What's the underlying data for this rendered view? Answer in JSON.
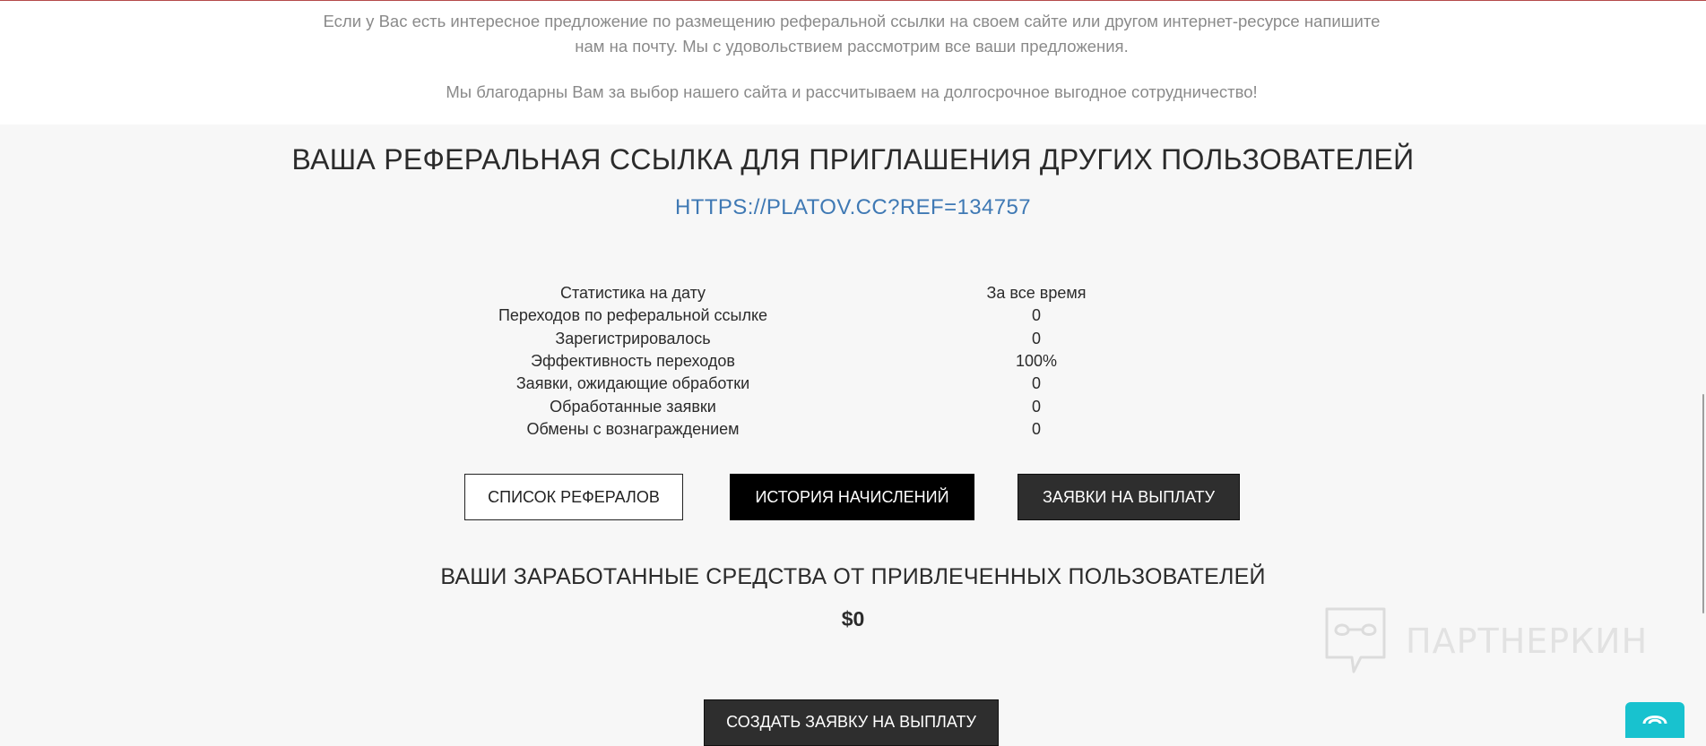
{
  "intro": {
    "paragraph1": "Если у Вас есть интересное предложение по размещению реферальной ссылки на своем сайте или другом интернет-ресурсе напишите нам на почту. Мы с удовольствием рассмотрим все ваши предложения.",
    "paragraph2": "Мы благодарны Вам за выбор нашего сайта и рассчитываем на долгосрочное выгодное сотрудничество!"
  },
  "referral": {
    "heading": "ВАША РЕФЕРАЛЬНАЯ ССЫЛКА ДЛЯ ПРИГЛАШЕНИЯ ДРУГИХ ПОЛЬЗОВАТЕЛЕЙ",
    "link": "HTTPS://PLATOV.CC?REF=134757"
  },
  "stats": {
    "header": [
      "Статистика на дату",
      "За все время"
    ],
    "rows": [
      [
        "Переходов по реферальной ссылке",
        "0"
      ],
      [
        "Зарегистрировалось",
        "0"
      ],
      [
        "Эффективность переходов",
        "100%"
      ],
      [
        "Заявки, ожидающие обработки",
        "0"
      ],
      [
        "Обработанные заявки",
        "0"
      ],
      [
        "Обмены с вознаграждением",
        "0"
      ]
    ]
  },
  "buttons": {
    "referrals_list": "СПИСОК РЕФЕРАЛОВ",
    "accrual_history": "ИСТОРИЯ НАЧИСЛЕНИЙ",
    "payout_requests": "ЗАЯВКИ НА ВЫПЛАТУ",
    "create_payout": "СОЗДАТЬ ЗАЯВКУ НА ВЫПЛАТУ"
  },
  "earnings": {
    "heading": "ВАШИ ЗАРАБОТАННЫЕ СРЕДСТВА ОТ ПРИВЛЕЧЕННЫХ ПОЛЬЗОВАТЕЛЕЙ",
    "amount": "$0"
  },
  "watermark": {
    "text": "ПАРТНЕРКИН",
    "icon": "partnerkin-logo-icon"
  },
  "chat": {
    "icon": "chat-widget-icon"
  },
  "colors": {
    "link": "#3f79b4",
    "chat": "#18c2cf",
    "top_border": "#b44a4a",
    "dark_button": "#2e2e2e"
  }
}
